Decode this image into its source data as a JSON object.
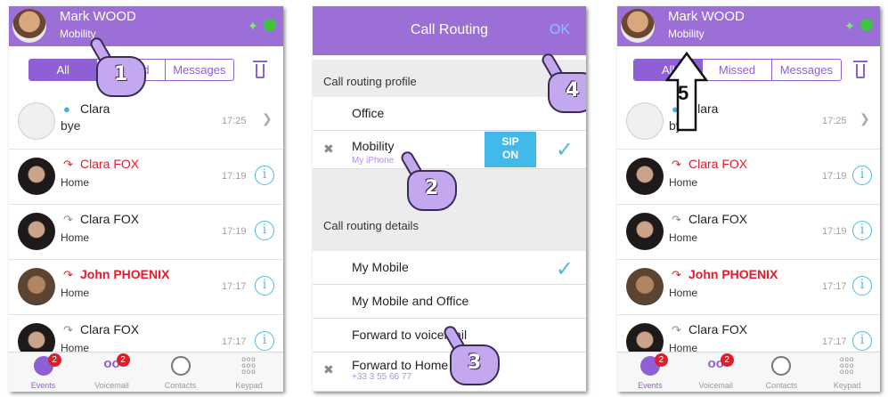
{
  "screens": [
    {
      "header": {
        "name": "Mark WOOD",
        "status": "Mobility"
      },
      "tabs": [
        "All",
        "Missed",
        "Messages"
      ],
      "active_tab": "All",
      "rows": [
        {
          "name": "Clara",
          "label": "bye",
          "time": "17:25",
          "type": "message"
        },
        {
          "name": "Clara FOX",
          "label": "Home",
          "time": "17:19",
          "type": "missed"
        },
        {
          "name": "Clara FOX",
          "label": "Home",
          "time": "17:19",
          "type": "call"
        },
        {
          "name": "John PHOENIX",
          "label": "Home",
          "time": "17:17",
          "type": "missed"
        },
        {
          "name": "Clara FOX",
          "label": "Home",
          "time": "17:17",
          "type": "call"
        }
      ],
      "tabbar": [
        {
          "label": "Events",
          "badge": "2"
        },
        {
          "label": "Voicemail",
          "badge": "2"
        },
        {
          "label": "Contacts",
          "badge": ""
        },
        {
          "label": "Keypad",
          "badge": ""
        }
      ],
      "step": "1"
    },
    {
      "header": {
        "title": "Call Routing",
        "ok": "OK"
      },
      "sections": {
        "profile": "Call routing profile",
        "details": "Call routing details"
      },
      "profile_options": [
        {
          "label": "Office",
          "sub": ""
        },
        {
          "label": "Mobility",
          "sub": "My iPhone",
          "sip_line1": "SIP",
          "sip_line2": "ON"
        }
      ],
      "detail_options": [
        {
          "label": "My Mobile"
        },
        {
          "label": "My Mobile and Office"
        },
        {
          "label": "Forward to voicemail"
        },
        {
          "label": "Forward to Home",
          "sub": "+33 3 55 66 77"
        }
      ],
      "steps": [
        "2",
        "3",
        "4"
      ]
    },
    {
      "header": {
        "name": "Mark WOOD",
        "status": "Mobility"
      },
      "tabs": [
        "All",
        "Missed",
        "Messages"
      ],
      "active_tab": "All",
      "rows": [
        {
          "name": "Clara",
          "label": "bye",
          "time": "17:25",
          "type": "message"
        },
        {
          "name": "Clara FOX",
          "label": "Home",
          "time": "17:19",
          "type": "missed"
        },
        {
          "name": "Clara FOX",
          "label": "Home",
          "time": "17:19",
          "type": "call"
        },
        {
          "name": "John PHOENIX",
          "label": "Home",
          "time": "17:17",
          "type": "missed"
        },
        {
          "name": "Clara FOX",
          "label": "Home",
          "time": "17:17",
          "type": "call"
        }
      ],
      "tabbar": [
        {
          "label": "Events",
          "badge": "2"
        },
        {
          "label": "Voicemail",
          "badge": "2"
        },
        {
          "label": "Contacts",
          "badge": ""
        },
        {
          "label": "Keypad",
          "badge": ""
        }
      ],
      "step": "5"
    }
  ],
  "colors": {
    "header": "#9b6fd6",
    "accent": "#8f5fd6",
    "missed": "#e21b2a",
    "info": "#4fb9e6",
    "sip": "#43b9ea"
  }
}
